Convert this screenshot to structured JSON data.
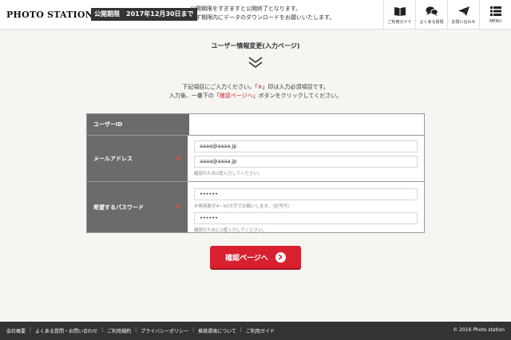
{
  "header": {
    "logo": "PHOTO STATION",
    "deadline_label": "公開期限",
    "deadline_date": "2017年12月30日まで",
    "notice_line1": "公開期限をすぎますと公開終了となります。",
    "notice_line2": "必ず期限内にデータのダウンロードをお願いいたします。",
    "nav": [
      {
        "label": "ご利用ガイド",
        "icon": "book-icon"
      },
      {
        "label": "よくある質問",
        "icon": "chat-bubbles-icon"
      },
      {
        "label": "お問い合わせ",
        "icon": "paper-plane-icon"
      },
      {
        "label": "MENU",
        "icon": "menu-list-icon"
      }
    ]
  },
  "page": {
    "title": "ユーザー情報変更(入力ページ)",
    "intro_line1_a": "下記項目にご入力ください。「",
    "intro_line1_mark": "※",
    "intro_line1_b": "」印は入力必須項目です。",
    "intro_line2_a": "入力後、一番下の「",
    "intro_line2_link": "確認ページへ",
    "intro_line2_b": "」ボタンをクリックしてください。"
  },
  "form": {
    "userid_label": "ユーザーID",
    "userid_value": "",
    "email_label": "メールアドレス",
    "email_required": "※",
    "email_value": "aaaa@aaaa.jp",
    "email_confirm_value": "aaaa@aaaa.jp",
    "email_help": "確認のため2度入力してください。",
    "password_label": "希望するパスワード",
    "password_required": "※",
    "password_value": "••••••",
    "password_help": "半角英数字4〜50文字でお願いします。（記号可）",
    "password_confirm_value": "••••••",
    "password_confirm_help": "確認のために2度入力してください。"
  },
  "confirm_button": {
    "label": "確認ページへ"
  },
  "footer": {
    "links": [
      "会社概要",
      "よくある質問・お問い合わせ",
      "ご利用規約",
      "プライバシーポリシー",
      "推奨環境について",
      "ご利用ガイド"
    ],
    "separator": "|",
    "copyright": "© 2016 Photo station"
  },
  "colors": {
    "accent_red": "#d8202f",
    "label_bg": "#6b6b6b",
    "footer_bg": "#333333"
  }
}
